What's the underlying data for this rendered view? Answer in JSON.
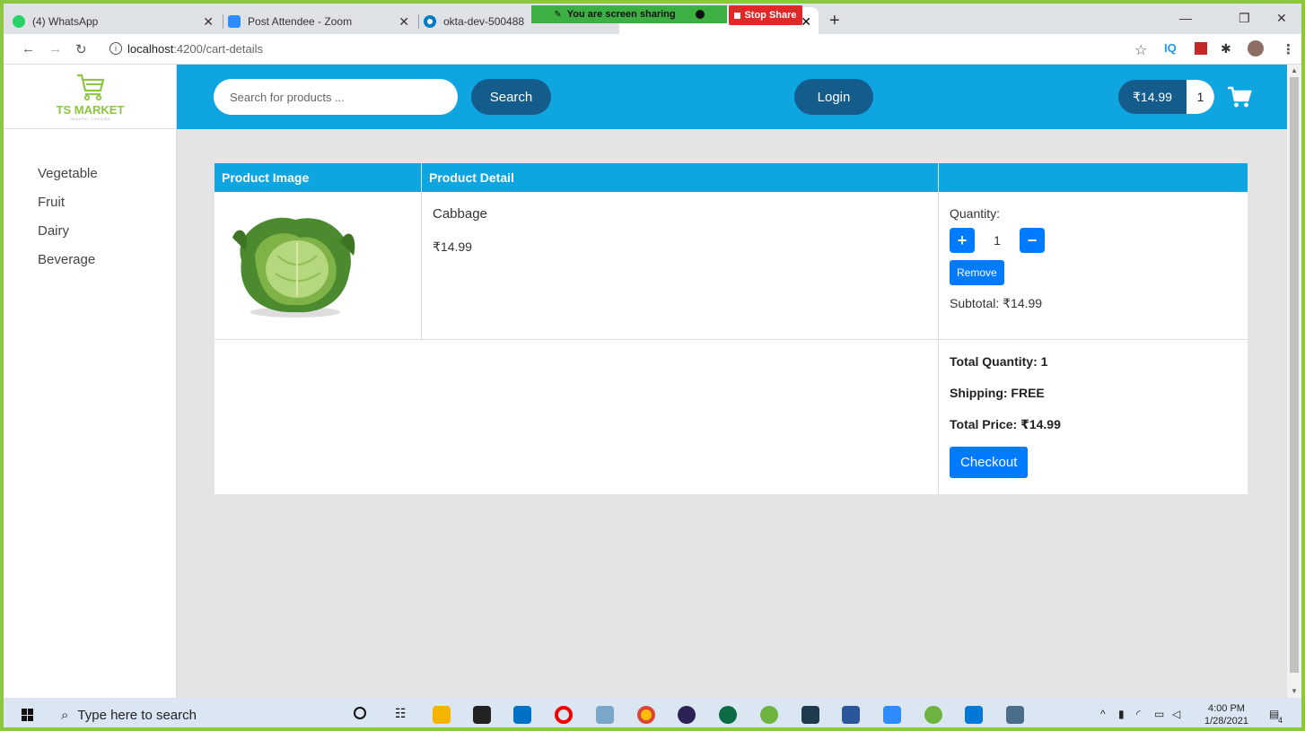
{
  "browser": {
    "tabs": [
      {
        "title": "(4) WhatsApp",
        "icon": "whatsapp-icon",
        "color": "#25d366"
      },
      {
        "title": "Post Attendee - Zoom",
        "icon": "zoom-icon",
        "color": "#2d8cff"
      },
      {
        "title": "okta-dev-500488",
        "icon": "okta-icon",
        "color": "#007dc1"
      }
    ],
    "share_banner": "You are screen sharing",
    "stop_share": "Stop Share",
    "url_host": "localhost",
    "url_rest": ":4200/cart-details",
    "ext_iq": "IQ"
  },
  "app": {
    "logo_text": "TS MARKET",
    "logo_tagline": "HEALTHY CHOICES",
    "categories": [
      "Vegetable",
      "Fruit",
      "Dairy",
      "Beverage"
    ],
    "search": {
      "placeholder": "Search for products ...",
      "button": "Search"
    },
    "login": "Login",
    "cart": {
      "total": "₹14.99",
      "count": "1"
    },
    "table": {
      "headers": [
        "Product Image",
        "Product Detail",
        ""
      ],
      "item": {
        "name": "Cabbage",
        "price": "₹14.99",
        "quantity_label": "Quantity:",
        "quantity": "1",
        "increment": "+",
        "decrement": "−",
        "remove": "Remove",
        "subtotal": "Subtotal: ₹14.99"
      },
      "totals": {
        "quantity": "Total Quantity: 1",
        "shipping": "Shipping: FREE",
        "price": "Total Price: ₹14.99",
        "checkout": "Checkout"
      }
    }
  },
  "taskbar": {
    "search_placeholder": "Type here to search",
    "time": "4:00 PM",
    "date": "1/28/2021",
    "notification_count": "4"
  },
  "colors": {
    "primary_blue": "#0ea5e0",
    "dark_blue": "#145c8c",
    "button_blue": "#007bff",
    "brand_green": "#8dc63f"
  }
}
